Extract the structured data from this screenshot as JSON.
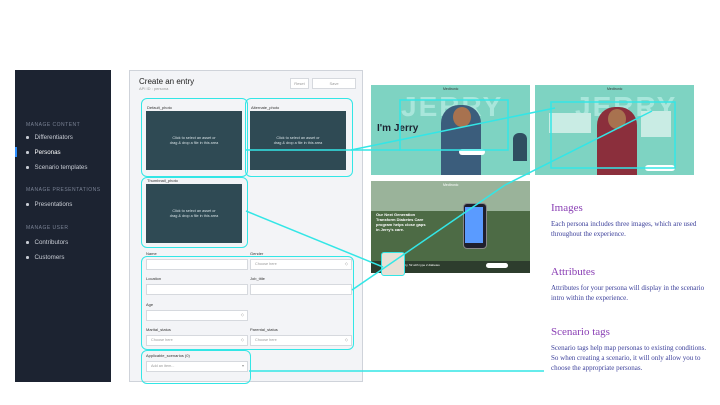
{
  "sidebar": {
    "sections": [
      {
        "title": "MANAGE CONTENT",
        "items": [
          "Differentiators",
          "Personas",
          "Scenario templates"
        ]
      },
      {
        "title": "MANAGE PRESENTATIONS",
        "items": [
          "Presentations"
        ]
      },
      {
        "title": "MANAGE USER",
        "items": [
          "Contributors",
          "Customers"
        ]
      }
    ],
    "active_item": "Personas"
  },
  "form": {
    "title": "Create an entry",
    "subtitle": "API ID : persona",
    "reset_label": "Reset",
    "save_label": "Save",
    "fields": {
      "default_photo": "Default_photo",
      "alternate_photo": "Alternate_photo",
      "thumbnail_photo": "Thumbnail_photo",
      "name": "Name",
      "gender": "Gender",
      "location": "Location",
      "job_title": "Job_title",
      "age": "Age",
      "marital_status": "Marital_status",
      "parental_status": "Parental_status",
      "applicable_scenarios": "Applicable_scenarios (0)"
    },
    "drop_text_1": "Click to select an asset or",
    "drop_text_2": "drag & drop a file in this area",
    "choose_here": "Choose here",
    "add_item": "Add an item..."
  },
  "previews": {
    "intro_greeting": "I'm Jerry",
    "bg_text": "JERRY",
    "brand": "Medtronic",
    "story_headline": "Our Next Generation Transform Diabetes Care program helps close gaps in Jerry's care.",
    "thumb_caption": "Jerry, 52 with type 2 diabetes"
  },
  "annotations": [
    {
      "heading": "Images",
      "body": "Each persona includes three images, which are used throughout the experience."
    },
    {
      "heading": "Attributes",
      "body": "Attributes for your persona will display in the scenario intro within the experience."
    },
    {
      "heading": "Scenario tags",
      "body": "Scenario tags help map personas to existing conditions. So when creating a scenario, it will only allow you to choose the appropriate personas."
    }
  ],
  "colors": {
    "highlight": "#33e6e6",
    "sidebar_bg": "#1c2331",
    "annotation_heading": "#8a3fb4",
    "annotation_body": "#3b3f9a",
    "preview_bg": "#7ed3c2"
  }
}
